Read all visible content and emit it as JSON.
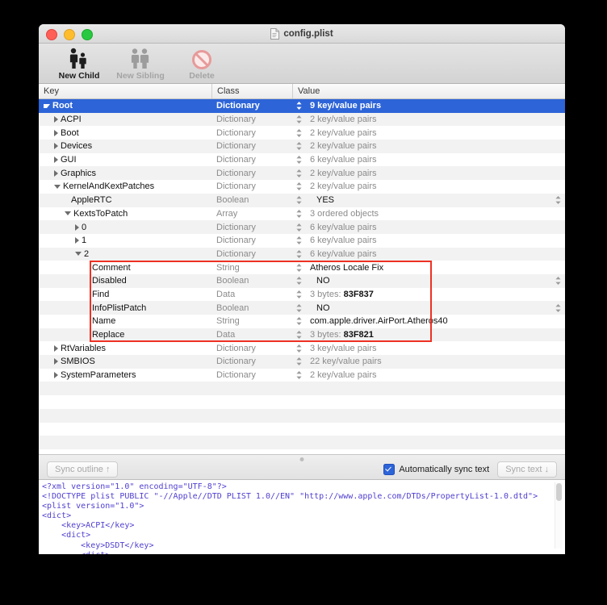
{
  "window": {
    "title": "config.plist",
    "doc_icon": "document-icon",
    "traffic_lights": [
      "close-button",
      "minimize-button",
      "zoom-button"
    ]
  },
  "toolbar": {
    "items": [
      {
        "label": "New Child",
        "icon": "two-people-icon",
        "enabled": true
      },
      {
        "label": "New Sibling",
        "icon": "two-people-icon",
        "enabled": false
      },
      {
        "label": "Delete",
        "icon": "prohibition-icon",
        "enabled": false
      }
    ]
  },
  "outline": {
    "columns": [
      "Key",
      "Class",
      "Value"
    ],
    "rows": [
      {
        "key": "Root",
        "indent": 0,
        "twisty": "down",
        "class": "Dictionary",
        "value": "9 key/value pairs",
        "selected": true,
        "stepper": true,
        "endstep": false,
        "bold_value": false
      },
      {
        "key": "ACPI",
        "indent": 1,
        "twisty": "right",
        "class": "Dictionary",
        "value": "2 key/value pairs",
        "selected": false,
        "stepper": true,
        "endstep": false,
        "bold_value": false
      },
      {
        "key": "Boot",
        "indent": 1,
        "twisty": "right",
        "class": "Dictionary",
        "value": "2 key/value pairs",
        "selected": false,
        "stepper": true,
        "endstep": false,
        "bold_value": false
      },
      {
        "key": "Devices",
        "indent": 1,
        "twisty": "right",
        "class": "Dictionary",
        "value": "2 key/value pairs",
        "selected": false,
        "stepper": true,
        "endstep": false,
        "bold_value": false
      },
      {
        "key": "GUI",
        "indent": 1,
        "twisty": "right",
        "class": "Dictionary",
        "value": "6 key/value pairs",
        "selected": false,
        "stepper": true,
        "endstep": false,
        "bold_value": false
      },
      {
        "key": "Graphics",
        "indent": 1,
        "twisty": "right",
        "class": "Dictionary",
        "value": "2 key/value pairs",
        "selected": false,
        "stepper": true,
        "endstep": false,
        "bold_value": false
      },
      {
        "key": "KernelAndKextPatches",
        "indent": 1,
        "twisty": "down",
        "class": "Dictionary",
        "value": "2 key/value pairs",
        "selected": false,
        "stepper": true,
        "endstep": false,
        "bold_value": false
      },
      {
        "key": "AppleRTC",
        "indent": 2,
        "twisty": "none",
        "class": "Boolean",
        "value": "YES",
        "selected": false,
        "stepper": true,
        "endstep": true,
        "bold_value": true
      },
      {
        "key": "KextsToPatch",
        "indent": 2,
        "twisty": "down",
        "class": "Array",
        "value": "3 ordered objects",
        "selected": false,
        "stepper": true,
        "endstep": false,
        "bold_value": false
      },
      {
        "key": "0",
        "indent": 3,
        "twisty": "right",
        "class": "Dictionary",
        "value": "6 key/value pairs",
        "selected": false,
        "stepper": true,
        "endstep": false,
        "bold_value": false
      },
      {
        "key": "1",
        "indent": 3,
        "twisty": "right",
        "class": "Dictionary",
        "value": "6 key/value pairs",
        "selected": false,
        "stepper": true,
        "endstep": false,
        "bold_value": false
      },
      {
        "key": "2",
        "indent": 3,
        "twisty": "down",
        "class": "Dictionary",
        "value": "6 key/value pairs",
        "selected": false,
        "stepper": true,
        "endstep": false,
        "bold_value": false
      },
      {
        "key": "Comment",
        "indent": 4,
        "twisty": "none",
        "class": "String",
        "value": "Atheros Locale Fix",
        "selected": false,
        "stepper": true,
        "endstep": false,
        "bold_value": true
      },
      {
        "key": "Disabled",
        "indent": 4,
        "twisty": "none",
        "class": "Boolean",
        "value": "NO",
        "selected": false,
        "stepper": true,
        "endstep": true,
        "bold_value": true
      },
      {
        "key": "Find",
        "indent": 4,
        "twisty": "none",
        "class": "Data",
        "value": "3 bytes: ",
        "value_hex": "83F837",
        "selected": false,
        "stepper": true,
        "endstep": false,
        "bold_value": false
      },
      {
        "key": "InfoPlistPatch",
        "indent": 4,
        "twisty": "none",
        "class": "Boolean",
        "value": "NO",
        "selected": false,
        "stepper": true,
        "endstep": true,
        "bold_value": true
      },
      {
        "key": "Name",
        "indent": 4,
        "twisty": "none",
        "class": "String",
        "value": "com.apple.driver.AirPort.Atheros40",
        "selected": false,
        "stepper": true,
        "endstep": false,
        "bold_value": true
      },
      {
        "key": "Replace",
        "indent": 4,
        "twisty": "none",
        "class": "Data",
        "value": "3 bytes: ",
        "value_hex": "83F821",
        "selected": false,
        "stepper": true,
        "endstep": false,
        "bold_value": false
      },
      {
        "key": "RtVariables",
        "indent": 1,
        "twisty": "right",
        "class": "Dictionary",
        "value": "3 key/value pairs",
        "selected": false,
        "stepper": true,
        "endstep": false,
        "bold_value": false
      },
      {
        "key": "SMBIOS",
        "indent": 1,
        "twisty": "right",
        "class": "Dictionary",
        "value": "22 key/value pairs",
        "selected": false,
        "stepper": true,
        "endstep": false,
        "bold_value": false
      },
      {
        "key": "SystemParameters",
        "indent": 1,
        "twisty": "right",
        "class": "Dictionary",
        "value": "2 key/value pairs",
        "selected": false,
        "stepper": true,
        "endstep": false,
        "bold_value": false
      }
    ],
    "empty_row_count": 12,
    "highlight": {
      "color": "#ee3124",
      "first_row_key": "Comment",
      "last_row_key": "Replace"
    }
  },
  "syncbar": {
    "sync_outline_label": "Sync outline ↑",
    "auto_sync_label": "Automatically sync text",
    "auto_sync_checked": true,
    "sync_text_label": "Sync text ↓"
  },
  "source": {
    "text": "<?xml version=\"1.0\" encoding=\"UTF-8\"?>\n<!DOCTYPE plist PUBLIC \"-//Apple//DTD PLIST 1.0//EN\" \"http://www.apple.com/DTDs/PropertyList-1.0.dtd\">\n<plist version=\"1.0\">\n<dict>\n    <key>ACPI</key>\n    <dict>\n        <key>DSDT</key>\n        <dict>",
    "color": "#4f3fd0"
  }
}
